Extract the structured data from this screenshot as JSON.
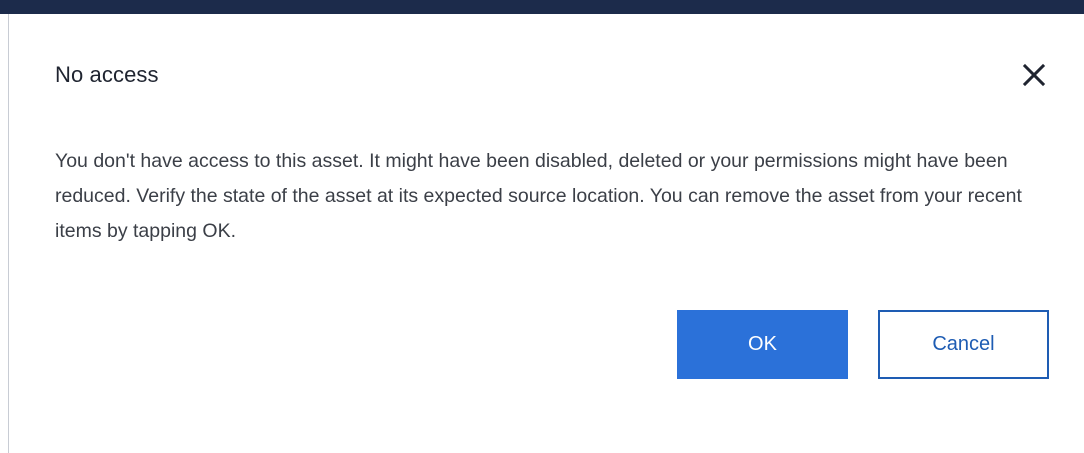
{
  "dialog": {
    "title": "No access",
    "message": "You don't have access to this asset. It might have been disabled, deleted or your permissions might have been reduced. Verify the state of the asset at its expected source location. You can remove the asset from your recent items by tapping OK.",
    "close_icon": "close-icon",
    "ok_label": "OK",
    "cancel_label": "Cancel"
  },
  "colors": {
    "top_bar": "#1c2b4b",
    "primary": "#2b71d9",
    "secondary_border": "#1e5cb3",
    "text": "#3b3f47"
  }
}
